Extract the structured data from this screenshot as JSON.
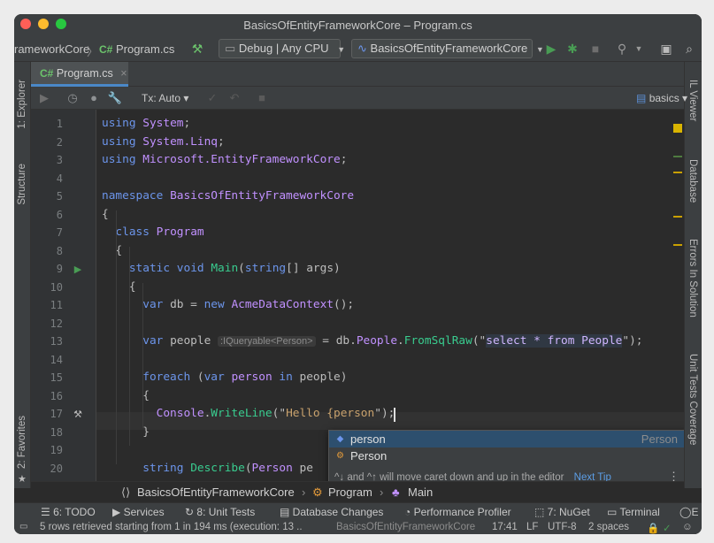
{
  "window": {
    "title": "BasicsOfEntityFrameworkCore – Program.cs"
  },
  "toolbar": {
    "crumb_project": "rameworkCore",
    "crumb_sep": "〉",
    "crumb_file_badge": "C#",
    "crumb_file": "Program.cs",
    "config_combo": "Debug | Any CPU",
    "project_combo": "BasicsOfEntityFrameworkCore"
  },
  "left_strip": {
    "project_label": "1: Explorer",
    "structure_label": "Structure",
    "favorites_label": "2: Favorites"
  },
  "right_strip": {
    "il_label": "IL Viewer",
    "database_label": "Database",
    "errors_label": "Errors In Solution",
    "tests_label": "Unit Tests Coverage"
  },
  "tabs": [
    {
      "badge": "C#",
      "label": "Program.cs",
      "close": "×"
    }
  ],
  "db_toolbar": {
    "tx_label": "Tx: Auto",
    "tx_caret": "▾",
    "schema": "basics",
    "schema_caret": "▾"
  },
  "editor": {
    "line_numbers": [
      "1",
      "2",
      "3",
      "4",
      "5",
      "6",
      "7",
      "8",
      "9",
      "10",
      "11",
      "12",
      "13",
      "14",
      "15",
      "16",
      "17",
      "18",
      "19",
      "20"
    ],
    "lines": [
      [
        {
          "t": "using",
          "c": "kw"
        },
        {
          "t": " "
        },
        {
          "t": "System",
          "c": "cls"
        },
        {
          "t": ";"
        }
      ],
      [
        {
          "t": "using",
          "c": "kw"
        },
        {
          "t": " "
        },
        {
          "t": "System.Linq",
          "c": "cls"
        },
        {
          "t": ";"
        }
      ],
      [
        {
          "t": "using",
          "c": "kw"
        },
        {
          "t": " "
        },
        {
          "t": "Microsoft.EntityFrameworkCore",
          "c": "cls"
        },
        {
          "t": ";"
        }
      ],
      [],
      [
        {
          "t": "namespace",
          "c": "kw"
        },
        {
          "t": " "
        },
        {
          "t": "BasicsOfEntityFrameworkCore",
          "c": "cls"
        }
      ],
      [
        {
          "t": "{"
        }
      ],
      [
        {
          "t": "  "
        },
        {
          "t": "class",
          "c": "kw"
        },
        {
          "t": " "
        },
        {
          "t": "Program",
          "c": "cls"
        }
      ],
      [
        {
          "t": "  {"
        }
      ],
      [
        {
          "t": "    "
        },
        {
          "t": "static",
          "c": "kw"
        },
        {
          "t": " "
        },
        {
          "t": "void",
          "c": "kw"
        },
        {
          "t": " "
        },
        {
          "t": "Main",
          "c": "fn"
        },
        {
          "t": "("
        },
        {
          "t": "string",
          "c": "kw"
        },
        {
          "t": "[] args)"
        }
      ],
      [
        {
          "t": "    {"
        }
      ],
      [
        {
          "t": "      "
        },
        {
          "t": "var",
          "c": "kw"
        },
        {
          "t": " db = "
        },
        {
          "t": "new",
          "c": "kw"
        },
        {
          "t": " "
        },
        {
          "t": "AcmeDataContext",
          "c": "cls"
        },
        {
          "t": "();"
        }
      ],
      [],
      [
        {
          "t": "      "
        },
        {
          "t": "var",
          "c": "kw"
        },
        {
          "t": " people "
        },
        {
          "t": ":IQueryable<Person>",
          "c": "hint"
        },
        {
          "t": " = db."
        },
        {
          "t": "People",
          "c": "cls"
        },
        {
          "t": "."
        },
        {
          "t": "FromSqlRaw",
          "c": "fn"
        },
        {
          "t": "(\""
        },
        {
          "t": "select",
          "c": "sqlhl kw"
        },
        {
          "t": " * ",
          "c": "sqlhl"
        },
        {
          "t": "from",
          "c": "sqlhl kw"
        },
        {
          "t": " People",
          "c": "sqlhl"
        },
        {
          "t": "\");"
        }
      ],
      [],
      [
        {
          "t": "      "
        },
        {
          "t": "foreach",
          "c": "kw"
        },
        {
          "t": " ("
        },
        {
          "t": "var",
          "c": "kw"
        },
        {
          "t": " "
        },
        {
          "t": "person",
          "c": "cls"
        },
        {
          "t": " "
        },
        {
          "t": "in",
          "c": "kw"
        },
        {
          "t": " people)"
        }
      ],
      [
        {
          "t": "      {"
        }
      ],
      [
        {
          "t": "        "
        },
        {
          "t": "Console",
          "c": "cls"
        },
        {
          "t": "."
        },
        {
          "t": "WriteLine",
          "c": "fn"
        },
        {
          "t": "(\""
        },
        {
          "t": "Hello {person",
          "c": "str"
        },
        {
          "t": "\");"
        }
      ],
      [
        {
          "t": "      }"
        }
      ],
      [],
      [
        {
          "t": "      "
        },
        {
          "t": "string",
          "c": "kw"
        },
        {
          "t": " "
        },
        {
          "t": "Describe",
          "c": "fn"
        },
        {
          "t": "("
        },
        {
          "t": "Person",
          "c": "cls"
        },
        {
          "t": " pe"
        }
      ]
    ]
  },
  "completion": {
    "items": [
      {
        "label": "person",
        "type": "Person"
      },
      {
        "label": "Person",
        "type": ""
      }
    ],
    "tip": "^↓ and ^↑ will move caret down and up in the editor",
    "tip_link": "Next Tip",
    "more": "⋮"
  },
  "navbar": {
    "namespace": "BasicsOfEntityFrameworkCore",
    "class": "Program",
    "method": "Main",
    "sep": "›"
  },
  "tool_windows": [
    "6: TODO",
    "Services",
    "8: Unit Tests",
    "Database Changes",
    "Performance Profiler",
    "7: NuGet",
    "Terminal",
    "E"
  ],
  "status": {
    "message": "5 rows retrieved starting from 1 in 194 ms (execution: 13 ..",
    "project": "BasicsOfEntityFrameworkCore",
    "position": "17:41",
    "line_ending": "LF",
    "encoding": "UTF-8",
    "indent": "2 spaces"
  },
  "colors": {
    "accent": "#4a88c7",
    "keyword": "#6c95eb",
    "class": "#c191ff",
    "method": "#39cc8f",
    "string": "#c9a26d",
    "run": "#499c54"
  }
}
